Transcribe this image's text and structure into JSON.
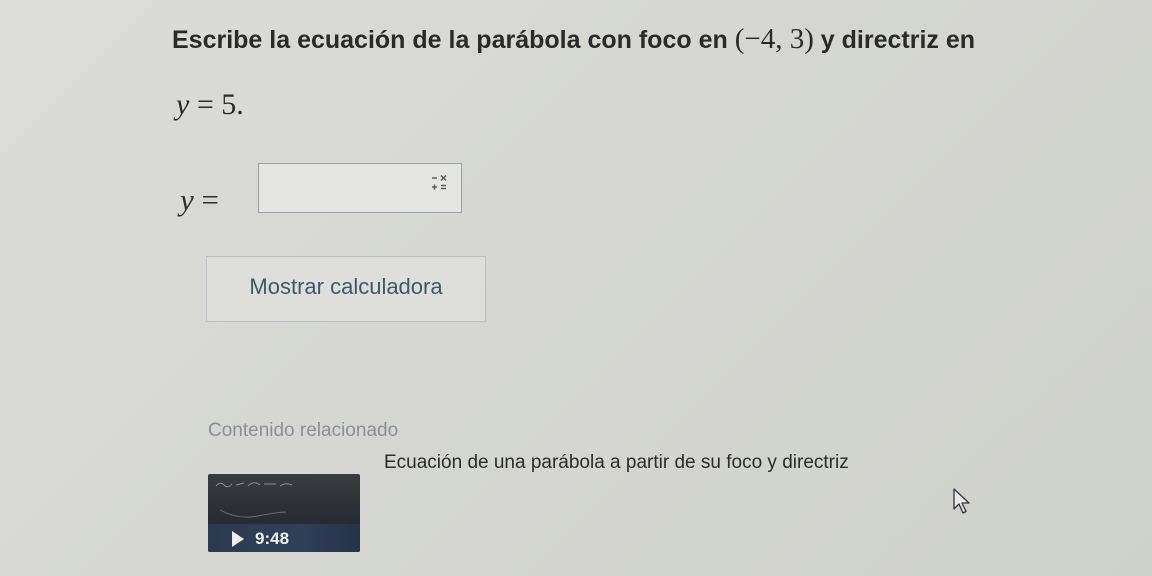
{
  "question": {
    "text_before": "Escribe la ecuación de la parábola con foco en ",
    "focus_point": "(−4, 3)",
    "text_after": " y directriz en",
    "directrix_var": "y",
    "directrix_eq": " = 5."
  },
  "answer": {
    "label_var": "y",
    "label_eq": " =",
    "value": "",
    "keypad_icon": "math-keypad-icon"
  },
  "calculator_button": {
    "label": "Mostrar calculadora"
  },
  "related": {
    "heading": "Contenido relacionado",
    "video": {
      "title": "Ecuación de una parábola a partir de su foco y directriz",
      "duration": "9:48",
      "play_icon": "play-icon"
    }
  },
  "cursor_icon": "mouse-pointer-icon"
}
